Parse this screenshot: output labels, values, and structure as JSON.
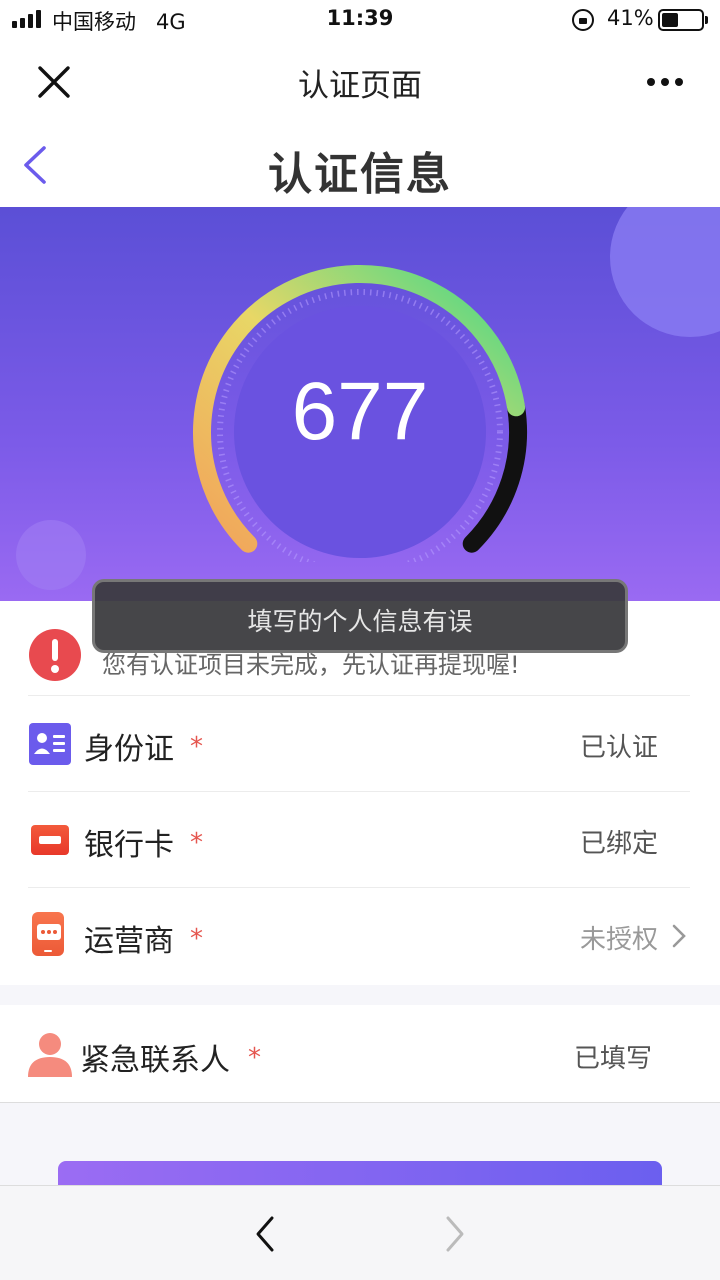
{
  "status_bar": {
    "carrier": "中国移动",
    "network": "4G",
    "time": "11:39",
    "battery_percent_text": "41%",
    "battery_level": 0.41,
    "icons": [
      "signal-icon",
      "orientation-lock-icon",
      "battery-icon"
    ]
  },
  "topbar": {
    "title": "认证页面",
    "icons": [
      "close-icon",
      "more-icon"
    ]
  },
  "page_header": {
    "title": "认证信息",
    "icons": [
      "back-chevron-icon"
    ]
  },
  "hero": {
    "score": "677",
    "gauge_level": 0.8,
    "colors": {
      "gradient_start": "#f2a35a",
      "gradient_mid": "#e8d766",
      "gradient_end": "#3fd88a",
      "remainder": "#111111"
    }
  },
  "notice": {
    "text": "您有认证项目未完成，先认证再提现喔!",
    "icon": "alert-icon"
  },
  "items": [
    {
      "label": "身份证",
      "required": "*",
      "status": "已认证",
      "icon": "id-card-icon"
    },
    {
      "label": "银行卡",
      "required": "*",
      "status": "已绑定",
      "icon": "bank-card-icon"
    },
    {
      "label": "运营商",
      "required": "*",
      "status": "未授权",
      "icon": "carrier-icon"
    }
  ],
  "emergency": {
    "label": "紧急联系人",
    "required": "*",
    "status": "已填写",
    "icon": "person-icon"
  },
  "toast": {
    "text": "填写的个人信息有误"
  },
  "colors": {
    "accent": "#6b5bec",
    "required": "#e5564f",
    "alert": "#e84a4f"
  }
}
